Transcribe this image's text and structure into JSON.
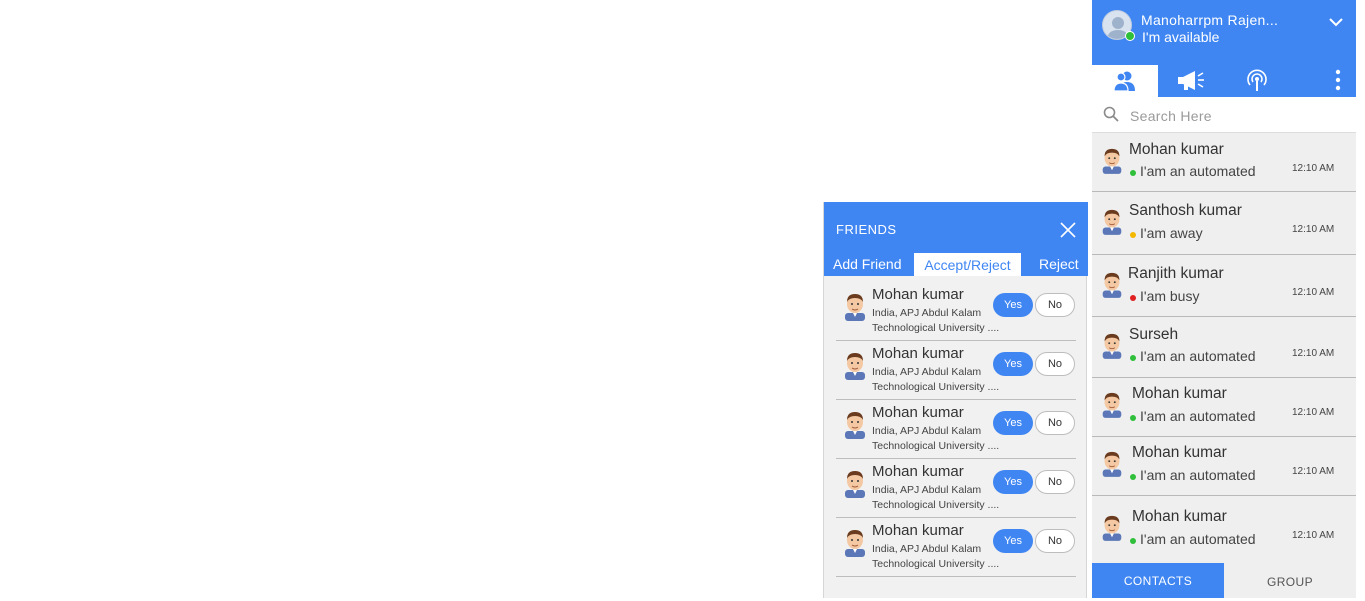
{
  "friends_popup": {
    "title": "FRIENDS",
    "tabs": [
      {
        "label": "Add Friend"
      },
      {
        "label": "Accept/Reject"
      },
      {
        "label": "Reject"
      }
    ],
    "requests": [
      {
        "name": "Mohan kumar",
        "line1": "India, APJ Abdul Kalam",
        "line2": "Technological University ....",
        "yes": "Yes",
        "no": "No"
      },
      {
        "name": "Mohan kumar",
        "line1": "India, APJ Abdul Kalam",
        "line2": "Technological University ....",
        "yes": "Yes",
        "no": "No"
      },
      {
        "name": "Mohan kumar",
        "line1": "India, APJ Abdul Kalam",
        "line2": "Technological University ....",
        "yes": "Yes",
        "no": "No"
      },
      {
        "name": "Mohan kumar",
        "line1": "India, APJ Abdul Kalam",
        "line2": "Technological University ....",
        "yes": "Yes",
        "no": "No"
      },
      {
        "name": "Mohan kumar",
        "line1": "India, APJ Abdul Kalam",
        "line2": "Technological University ....",
        "yes": "Yes",
        "no": "No"
      }
    ]
  },
  "panel": {
    "user_name": "Manoharrpm Rajen...",
    "user_status": "I'm available",
    "tab_icons": [
      "contacts-icon",
      "megaphone-icon",
      "broadcast-icon"
    ],
    "search_placeholder": "Search Here",
    "contacts": [
      {
        "name": "Mohan kumar",
        "status": "I'am an automated",
        "status_color": "#2fbf3a",
        "time": "12:10 AM"
      },
      {
        "name": "Santhosh kumar",
        "status": "I'am away",
        "status_color": "#f5b800",
        "time": "12:10 AM"
      },
      {
        "name": "Ranjith kumar",
        "status": "I'am busy",
        "status_color": "#e02020",
        "time": "12:10 AM"
      },
      {
        "name": "Surseh",
        "status": "I'am an automated",
        "status_color": "#2fbf3a",
        "time": "12:10 AM"
      },
      {
        "name": "Mohan kumar",
        "status": "I'am an automated",
        "status_color": "#2fbf3a",
        "time": "12:10 AM"
      },
      {
        "name": "Mohan kumar",
        "status": "I'am an automated",
        "status_color": "#2fbf3a",
        "time": "12:10 AM"
      },
      {
        "name": "Mohan kumar",
        "status": "I'am an automated",
        "status_color": "#2fbf3a",
        "time": "12:10 AM"
      }
    ],
    "footer_tabs": [
      "CONTACTS",
      "GROUP"
    ]
  },
  "colors": {
    "accent": "#3f86f2",
    "online": "#2fbf3a",
    "away": "#f5b800",
    "busy": "#e02020"
  }
}
